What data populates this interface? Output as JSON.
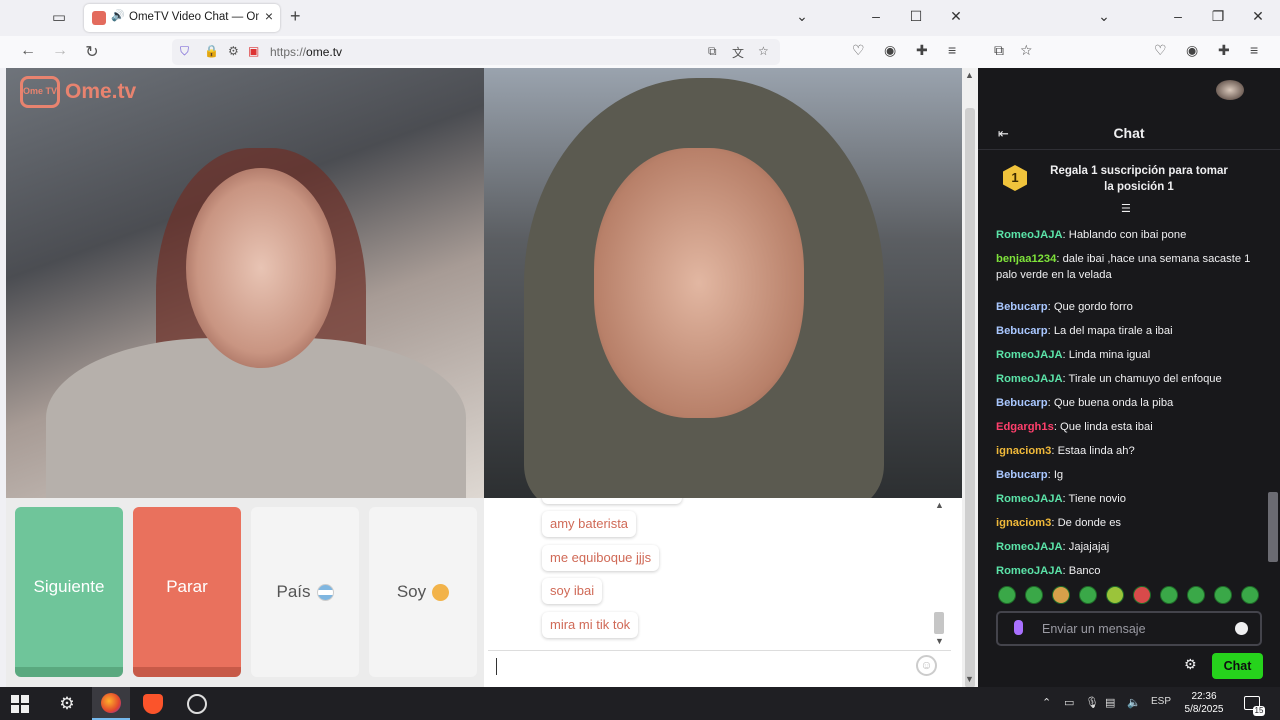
{
  "browser": {
    "tab_title": "OmeTV Video Chat — Ome",
    "url_prefix": "https://",
    "url_host": "ome.tv"
  },
  "ometv": {
    "logo_badge": "Ome TV",
    "logo_text": "Ome.tv",
    "buttons": {
      "next": "Siguiente",
      "stop": "Parar",
      "country": "País",
      "soy": "Soy"
    },
    "messages": [
      "amy baterista",
      "me equiboque jjjs",
      "soy ibai",
      "mira mi tik tok"
    ]
  },
  "twitch": {
    "chat_title": "Chat",
    "promo_badge": "1",
    "promo_text": "Regala 1 suscripción para tomar la posición 1",
    "messages": [
      {
        "user": "RomeoJAJA",
        "color": "#5be3a8",
        "text": "Hablando con ibai pone"
      },
      {
        "user": "benjaa1234",
        "color": "#7ee33a",
        "text": "dale ibai ,hace una semana sacaste 1 palo verde en la velada"
      },
      {
        "user": "Bebucarp",
        "color": "#a9c7ff",
        "text": "Que gordo forro"
      },
      {
        "user": "Bebucarp",
        "color": "#a9c7ff",
        "text": "La del mapa tirale a ibai"
      },
      {
        "user": "RomeoJAJA",
        "color": "#5be3a8",
        "text": "Linda mina igual"
      },
      {
        "user": "RomeoJAJA",
        "color": "#5be3a8",
        "text": "Tirale un chamuyo del enfoque"
      },
      {
        "user": "Bebucarp",
        "color": "#a9c7ff",
        "text": "Que buena onda la piba"
      },
      {
        "user": "Edgargh1s",
        "color": "#ff3f6c",
        "text": "Que linda esta ibai"
      },
      {
        "user": "ignaciom3",
        "color": "#f0b93a",
        "text": "Estaa linda ah?"
      },
      {
        "user": "Bebucarp",
        "color": "#a9c7ff",
        "text": "Ig"
      },
      {
        "user": "RomeoJAJA",
        "color": "#5be3a8",
        "text": "Tiene novio"
      },
      {
        "user": "ignaciom3",
        "color": "#f0b93a",
        "text": "De donde es"
      },
      {
        "user": "RomeoJAJA",
        "color": "#5be3a8",
        "text": "Jajajajaj"
      },
      {
        "user": "RomeoJAJA",
        "color": "#5be3a8",
        "text": "Banco"
      }
    ],
    "input_placeholder": "Enviar un mensaje",
    "chat_button": "Chat"
  },
  "taskbar": {
    "language": "ESP",
    "time": "22:36",
    "date": "5/8/2025",
    "notifications": "15"
  }
}
